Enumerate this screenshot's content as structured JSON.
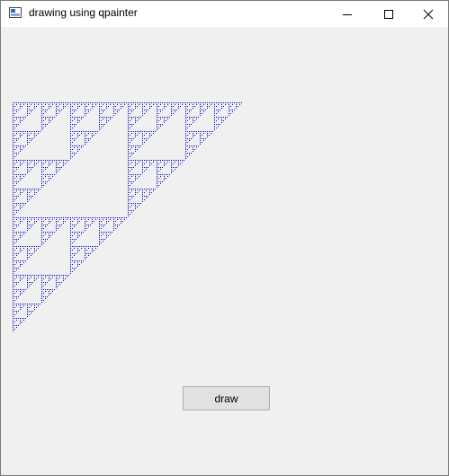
{
  "window": {
    "title": "drawing using qpainter"
  },
  "icons": {
    "app": "application-window-icon",
    "minimize": "minimize-icon",
    "maximize": "maximize-icon",
    "close": "close-icon"
  },
  "canvas": {
    "figure": "sierpinski-triangle",
    "color": "#0000cc"
  },
  "buttons": {
    "draw_label": "draw"
  }
}
